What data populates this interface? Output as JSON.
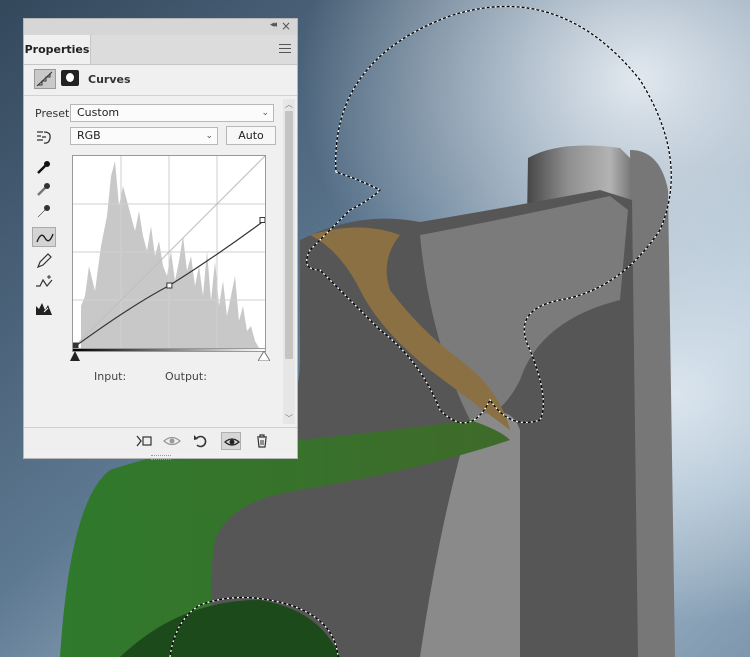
{
  "panel": {
    "tab_label": "Properties",
    "adjustment_title": "Curves",
    "preset_label": "Preset:",
    "preset_value": "Custom",
    "channel_value": "RGB",
    "auto_label": "Auto",
    "input_label": "Input:",
    "output_label": "Output:",
    "collapse_glyph": "◂◂",
    "close_glyph": "×"
  },
  "tools": [
    {
      "name": "on-image-adjust-icon"
    },
    {
      "name": "sample-black-point-eyedropper-icon"
    },
    {
      "name": "sample-gray-point-eyedropper-icon"
    },
    {
      "name": "sample-white-point-eyedropper-icon"
    },
    {
      "name": "curve-points-icon",
      "active": true
    },
    {
      "name": "pencil-icon"
    },
    {
      "name": "smooth-curve-icon"
    },
    {
      "name": "clipping-warning-icon"
    }
  ],
  "bottom_icons": [
    {
      "name": "clip-to-layer-icon"
    },
    {
      "name": "view-previous-state-icon"
    },
    {
      "name": "reset-icon"
    },
    {
      "name": "visibility-eye-icon",
      "active": true
    },
    {
      "name": "trash-icon"
    }
  ],
  "curve_points": [
    [
      0,
      0
    ],
    [
      128,
      83
    ],
    [
      255,
      170
    ]
  ],
  "colors": {
    "panel_bg": "#f0f0f0",
    "histogram": "#c8c8c8",
    "curve": "#333333",
    "sky": "#4a6278",
    "grass": "#2f6b2a",
    "rock": "#6e6e6e"
  }
}
